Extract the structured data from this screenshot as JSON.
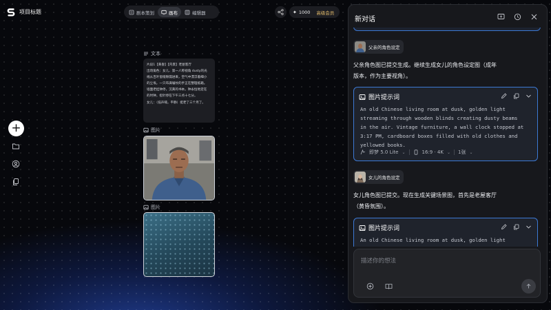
{
  "app": {
    "project_title": "项目标题"
  },
  "top_tabs": [
    {
      "label": "剧本策划",
      "icon": "script-icon",
      "active": false
    },
    {
      "label": "画布",
      "icon": "canvas-icon",
      "active": true
    },
    {
      "label": "编辑器",
      "icon": "editor-icon",
      "active": false
    }
  ],
  "credits": {
    "value": "1000",
    "membership": "高级会员"
  },
  "canvas": {
    "text_node": {
      "label": "文本",
      "lines": [
        "片段1【黄昏】【内景】老屋客厅",
        "出场角色：女儿、第一人称视角 dusty的光",
        "线从百叶窗缝隙漏进来，空气中漂浮着细小",
        "的尘埃。一只布满皱纹的手正在整理纸箱。",
        "墙面老挂钟停，沉黄的书本。钟永恒地定在",
        "的时钟，指针停在下午三点十七分。",
        "女儿：（低声喃，平静）挺老了三个月了。"
      ]
    },
    "image_node": {
      "label": "图片"
    },
    "placeholder_node": {
      "label": "图片"
    }
  },
  "chat": {
    "title": "新对话",
    "messages": [
      {
        "type": "chip",
        "label": "父亲的角色设定"
      },
      {
        "type": "text",
        "lines": [
          "父亲角色图已提交生成。继续生成女儿的角色设定图（成年",
          "版本，作为主要视角）。"
        ]
      },
      {
        "type": "prompt_card",
        "title": "图片提示词",
        "lines": [
          "An old Chinese living room at dusk, golden light",
          "streaming through wooden blinds creating dusty beams",
          "in the air. Vintage furniture, a wall clock stopped at",
          "3:17 PM, cardboard boxes filled with old clothes and",
          "yellowed books."
        ],
        "model": "即梦 5.0 Lite",
        "ratio": "16:9 · 4K",
        "count": "1张"
      },
      {
        "type": "chip",
        "label": "女儿的角色设定"
      },
      {
        "type": "text",
        "lines": [
          "女儿角色图已提交。现在生成关键场景图，首先是老屋客厅",
          "（黄昏氛围）。"
        ]
      },
      {
        "type": "prompt_card",
        "title": "图片提示词",
        "lines": [
          "An old Chinese living room at dusk, golden light"
        ]
      }
    ],
    "composer": {
      "placeholder": "描述你的想法"
    }
  }
}
